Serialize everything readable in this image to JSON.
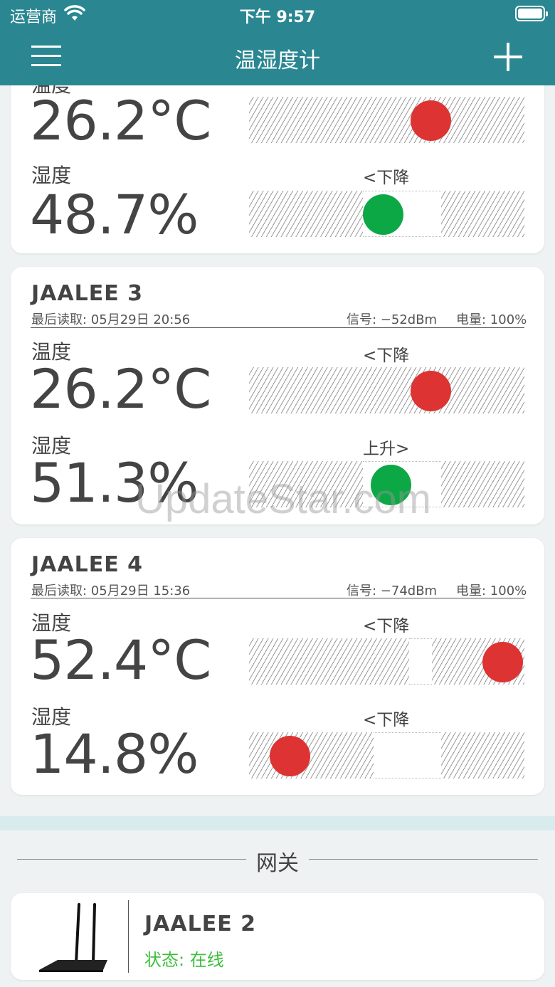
{
  "status_bar": {
    "carrier": "运营商",
    "time": "下午 9:57"
  },
  "nav": {
    "title": "温湿度计"
  },
  "devices": [
    {
      "name": "",
      "last_read": "",
      "signal": "",
      "battery": "",
      "temp_label": "温度",
      "temp_value": "26.2°C",
      "temp_trend": "",
      "temp_level": 0.66,
      "temp_color": "#dd3333",
      "hum_label": "湿度",
      "hum_value": "48.7%",
      "hum_trend": "<下降",
      "hum_level": 0.487,
      "hum_color": "#0da846"
    },
    {
      "name": "JAALEE 3",
      "last_read": "最后读取: 05月29日 20:56",
      "signal": "信号: −52dBm",
      "battery": "电量: 100%",
      "temp_label": "温度",
      "temp_value": "26.2°C",
      "temp_trend": "<下降",
      "temp_level": 0.66,
      "temp_color": "#dd3333",
      "hum_label": "湿度",
      "hum_value": "51.3%",
      "hum_trend": "上升>",
      "hum_level": 0.513,
      "hum_color": "#0da846"
    },
    {
      "name": "JAALEE 4",
      "last_read": "最后读取: 05月29日 15:36",
      "signal": "信号: −74dBm",
      "battery": "电量: 100%",
      "temp_label": "温度",
      "temp_value": "52.4°C",
      "temp_trend": "<下降",
      "temp_level": 0.92,
      "temp_color": "#dd3333",
      "hum_label": "湿度",
      "hum_value": "14.8%",
      "hum_trend": "<下降",
      "hum_level": 0.148,
      "hum_color": "#dd3333"
    }
  ],
  "gateway": {
    "section_title": "网关",
    "name": "JAALEE 2",
    "status": "状态: 在线"
  },
  "watermark": "UpdateStar.com"
}
